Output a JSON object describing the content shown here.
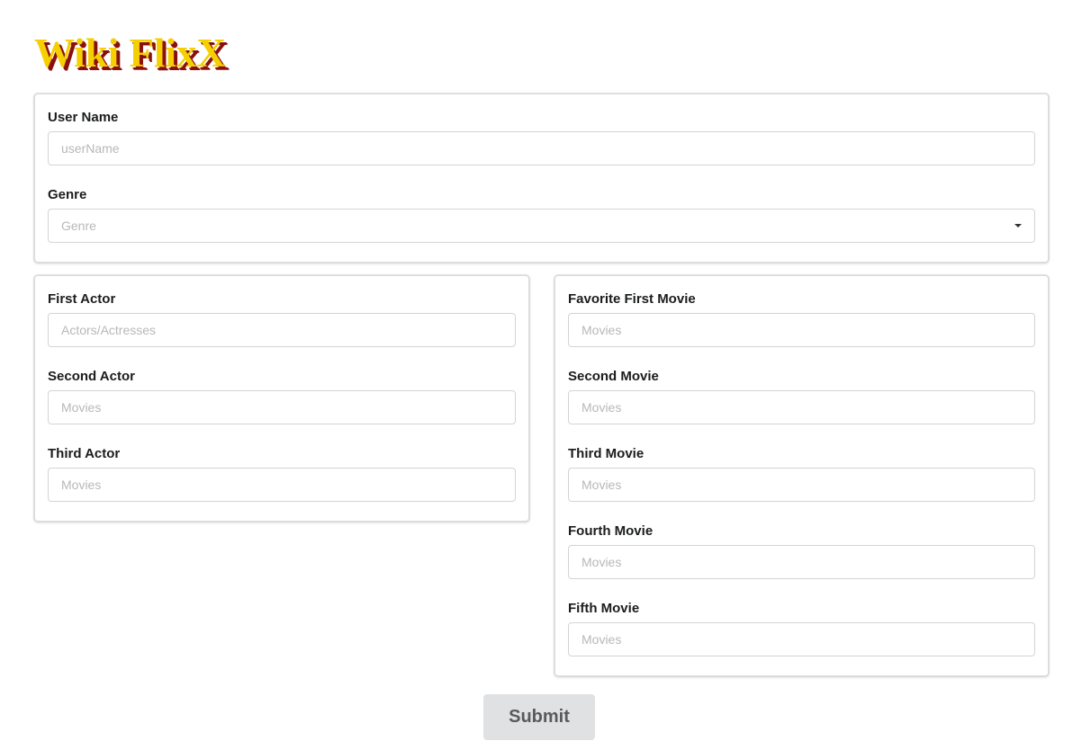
{
  "header": {
    "logo_text": "Wiki FlixX"
  },
  "profile": {
    "user_name": {
      "label": "User Name",
      "placeholder": "userName",
      "value": ""
    },
    "genre": {
      "label": "Genre",
      "placeholder": "Genre",
      "selected": ""
    }
  },
  "actors": [
    {
      "label": "First Actor",
      "placeholder": "Actors/Actresses",
      "value": ""
    },
    {
      "label": "Second Actor",
      "placeholder": "Movies",
      "value": ""
    },
    {
      "label": "Third Actor",
      "placeholder": "Movies",
      "value": ""
    }
  ],
  "movies": [
    {
      "label": "Favorite First Movie",
      "placeholder": "Movies",
      "value": ""
    },
    {
      "label": "Second Movie",
      "placeholder": "Movies",
      "value": ""
    },
    {
      "label": "Third Movie",
      "placeholder": "Movies",
      "value": ""
    },
    {
      "label": "Fourth Movie",
      "placeholder": "Movies",
      "value": ""
    },
    {
      "label": "Fifth Movie",
      "placeholder": "Movies",
      "value": ""
    }
  ],
  "submit": {
    "label": "Submit"
  },
  "colors": {
    "logo_fill": "#f5cf00",
    "logo_shadow": "#8a1010",
    "button_bg": "#e0e1e2"
  },
  "icons": {
    "genre_dropdown": "caret-down-icon"
  }
}
